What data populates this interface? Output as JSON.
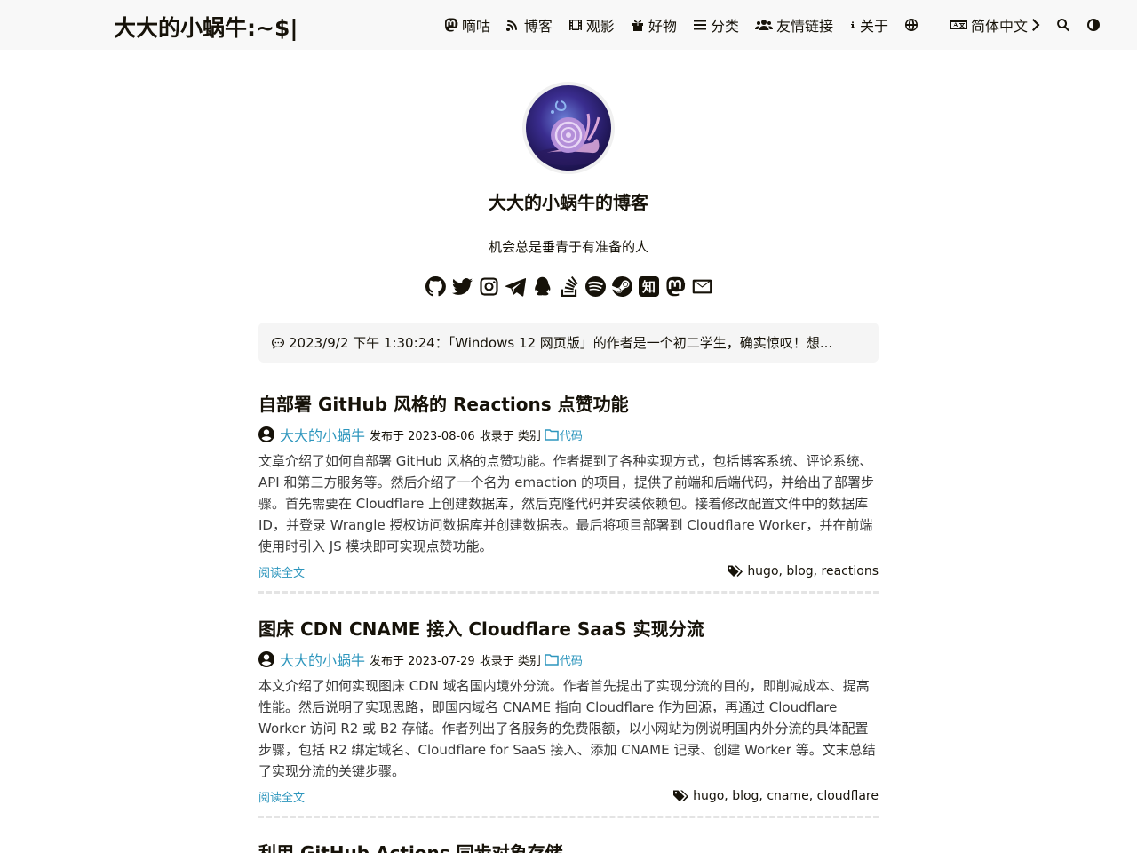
{
  "header": {
    "title": "大大的小蜗牛:~$|",
    "nav": [
      {
        "label": "嘀咕",
        "icon": "mastodon-icon"
      },
      {
        "label": "博客",
        "icon": "blog-icon"
      },
      {
        "label": "观影",
        "icon": "film-icon"
      },
      {
        "label": "好物",
        "icon": "gift-icon"
      },
      {
        "label": "分类",
        "icon": "list-icon"
      },
      {
        "label": "友情链接",
        "icon": "users-icon"
      },
      {
        "label": "关于",
        "icon": "info-icon"
      }
    ],
    "language": "简体中文"
  },
  "profile": {
    "name": "大大的小蜗牛的博客",
    "subtitle": "机会总是垂青于有准备的人",
    "social": [
      "github-icon",
      "twitter-icon",
      "instagram-icon",
      "telegram-icon",
      "qq-icon",
      "stackoverflow-icon",
      "spotify-icon",
      "steam-icon",
      "zhihu-icon",
      "mastodon-icon",
      "email-icon"
    ],
    "zhihu_char": "知"
  },
  "status": {
    "text": "2023/9/2 下午 1:30:24：「Windows 12 网页版」的作者是一个初二学生，确实惊叹！想..."
  },
  "posts": [
    {
      "title": "自部署 GitHub 风格的 Reactions 点赞功能",
      "author": "大大的小蜗牛",
      "published": "发布于 2023-08-06",
      "collected": "收录于 类别",
      "category": "代码",
      "summary": "文章介绍了如何自部署 GitHub 风格的点赞功能。作者提到了各种实现方式，包括博客系统、评论系统、API 和第三方服务等。然后介绍了一个名为 emaction 的项目，提供了前端和后端代码，并给出了部署步骤。首先需要在 Cloudflare 上创建数据库，然后克隆代码并安装依赖包。接着修改配置文件中的数据库 ID，并登录 Wrangle 授权访问数据库并创建数据表。最后将项目部署到 Cloudflare Worker，并在前端使用时引入 JS 模块即可实现点赞功能。",
      "read_more": "阅读全文",
      "tags": "hugo, blog, reactions"
    },
    {
      "title": "图床 CDN CNAME 接入 Cloudflare SaaS 实现分流",
      "author": "大大的小蜗牛",
      "published": "发布于 2023-07-29",
      "collected": "收录于 类别",
      "category": "代码",
      "summary": "本文介绍了如何实现图床 CDN 域名国内境外分流。作者首先提出了实现分流的目的，即削减成本、提高性能。然后说明了实现思路，即国内域名 CNAME 指向 Cloudflare 作为回源，再通过 Cloudflare Worker 访问 R2 或 B2 存储。作者列出了各服务的免费限额，以小网站为例说明国内外分流的具体配置步骤，包括 R2 绑定域名、Cloudflare for SaaS 接入、添加 CNAME 记录、创建 Worker 等。文末总结了实现分流的关键步骤。",
      "read_more": "阅读全文",
      "tags": "hugo, blog, cname, cloudflare"
    },
    {
      "title": "利用 GitHub Actions 同步对象存储"
    }
  ]
}
